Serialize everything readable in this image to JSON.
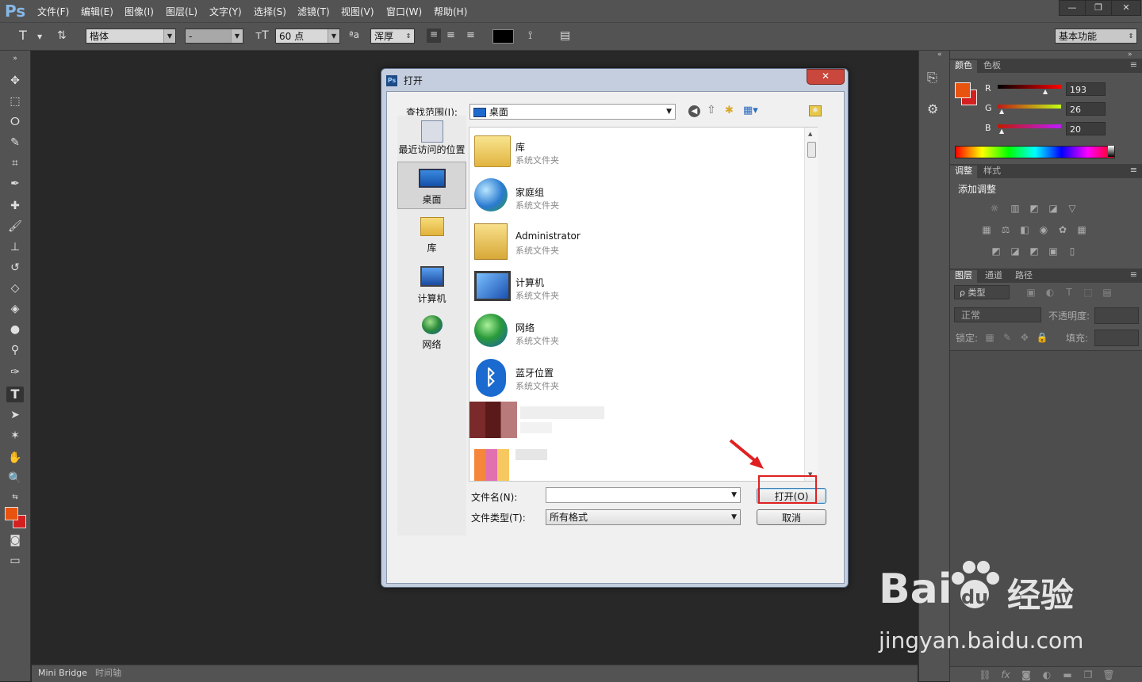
{
  "app": {
    "logo": "Ps"
  },
  "menu": [
    "文件(F)",
    "编辑(E)",
    "图像(I)",
    "图层(L)",
    "文字(Y)",
    "选择(S)",
    "滤镜(T)",
    "视图(V)",
    "窗口(W)",
    "帮助(H)"
  ],
  "window_controls": {
    "minimize": "—",
    "restore": "❐",
    "close": "✕"
  },
  "options": {
    "tool_glyph": "T",
    "font_family": "楷体",
    "font_style": "-",
    "font_size": "60 点",
    "aa_label": "ªa",
    "antialias": "浑厚",
    "workspace": "基本功能",
    "text_color": "#000000"
  },
  "colors": {
    "foreground": "#e8540f",
    "background": "#d42020",
    "accent_red": "#e02020"
  },
  "panels": {
    "color_tabs": [
      "颜色",
      "色板"
    ],
    "rgb": [
      {
        "label": "R",
        "value": "193"
      },
      {
        "label": "G",
        "value": "26"
      },
      {
        "label": "B",
        "value": "20"
      }
    ],
    "adjust_tabs": [
      "调整",
      "样式"
    ],
    "adjust_title": "添加调整",
    "layers_tabs": [
      "图层",
      "通道",
      "路径"
    ],
    "layer_filter": "ρ 类型",
    "blend_mode": "正常",
    "opacity_label": "不透明度:",
    "lock_label": "锁定:",
    "fill_label": "填充:"
  },
  "bottom_tabs": [
    "Mini Bridge",
    "时间轴"
  ],
  "dialog": {
    "title_icon": "Ps",
    "title": "打开",
    "close": "✕",
    "look_in_label": "查找范围(I):",
    "look_in_value": "桌面",
    "places": [
      {
        "label": "最近访问的位置",
        "icon": "recent-places-icon"
      },
      {
        "label": "桌面",
        "icon": "desktop-icon",
        "selected": true
      },
      {
        "label": "库",
        "icon": "library-icon"
      },
      {
        "label": "计算机",
        "icon": "computer-icon"
      },
      {
        "label": "网络",
        "icon": "network-icon"
      }
    ],
    "files": [
      {
        "name": "库",
        "type": "系统文件夹",
        "icon": "library-folder-icon"
      },
      {
        "name": "家庭组",
        "type": "系统文件夹",
        "icon": "homegroup-icon"
      },
      {
        "name": "Administrator",
        "type": "系统文件夹",
        "icon": "user-folder-icon"
      },
      {
        "name": "计算机",
        "type": "系统文件夹",
        "icon": "computer-icon"
      },
      {
        "name": "网络",
        "type": "系统文件夹",
        "icon": "network-icon"
      },
      {
        "name": "蓝牙位置",
        "type": "系统文件夹",
        "icon": "bluetooth-icon"
      }
    ],
    "filename_label": "文件名(N):",
    "filename_value": "",
    "filetype_label": "文件类型(T):",
    "filetype_value": "所有格式",
    "open_button": "打开(O)",
    "cancel_button": "取消"
  },
  "watermark": {
    "brand": "Bai",
    "brand2": "du",
    "suffix": "经验",
    "url": "jingyan.baidu.com"
  }
}
